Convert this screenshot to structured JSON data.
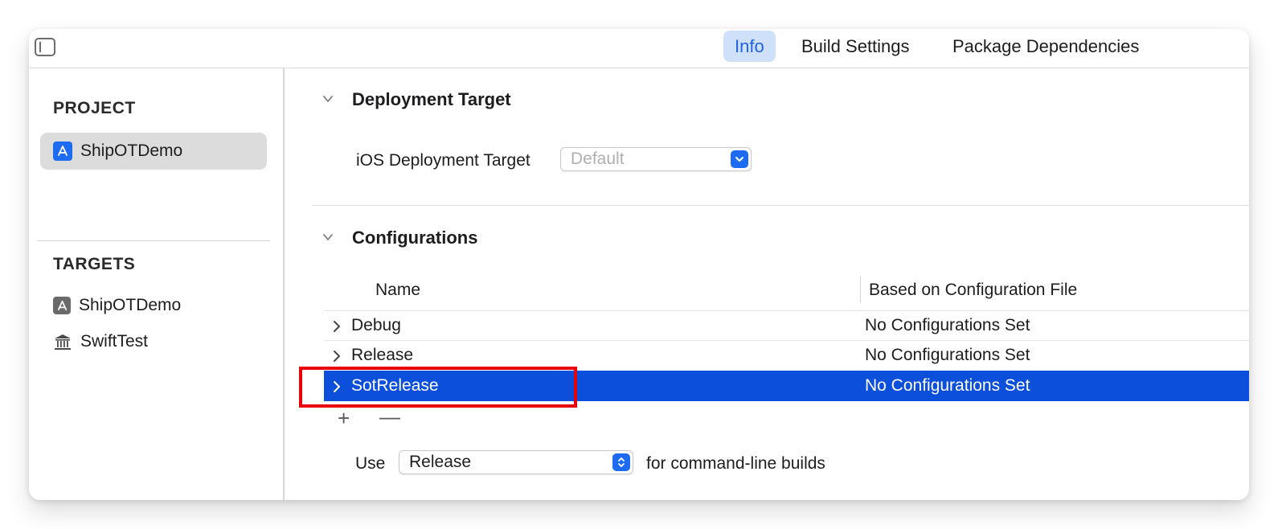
{
  "toolbar": {
    "tabs": [
      {
        "label": "Info",
        "active": true
      },
      {
        "label": "Build Settings",
        "active": false
      },
      {
        "label": "Package Dependencies",
        "active": false
      }
    ]
  },
  "sidebar": {
    "project_heading": "PROJECT",
    "project_items": [
      {
        "label": "ShipOTDemo",
        "icon": "app-icon",
        "selected": true
      }
    ],
    "targets_heading": "TARGETS",
    "target_items": [
      {
        "label": "ShipOTDemo",
        "icon": "app-icon"
      },
      {
        "label": "SwiftTest",
        "icon": "bank-icon"
      }
    ]
  },
  "deployment": {
    "title": "Deployment Target",
    "field_label": "iOS Deployment Target",
    "placeholder": "Default"
  },
  "configurations": {
    "title": "Configurations",
    "columns": [
      "Name",
      "Based on Configuration File"
    ],
    "rows": [
      {
        "name": "Debug",
        "file": "No Configurations Set",
        "selected": false
      },
      {
        "name": "Release",
        "file": "No Configurations Set",
        "selected": false
      },
      {
        "name": "SotRelease",
        "file": "No Configurations Set",
        "selected": true
      }
    ],
    "add_symbol": "+",
    "remove_symbol": "—",
    "use_label": "Use",
    "use_value": "Release",
    "use_suffix": "for command-line builds"
  },
  "colors": {
    "accent": "#1d6bf0",
    "selection": "#0b4fdb",
    "annotation": "#e8000b"
  }
}
